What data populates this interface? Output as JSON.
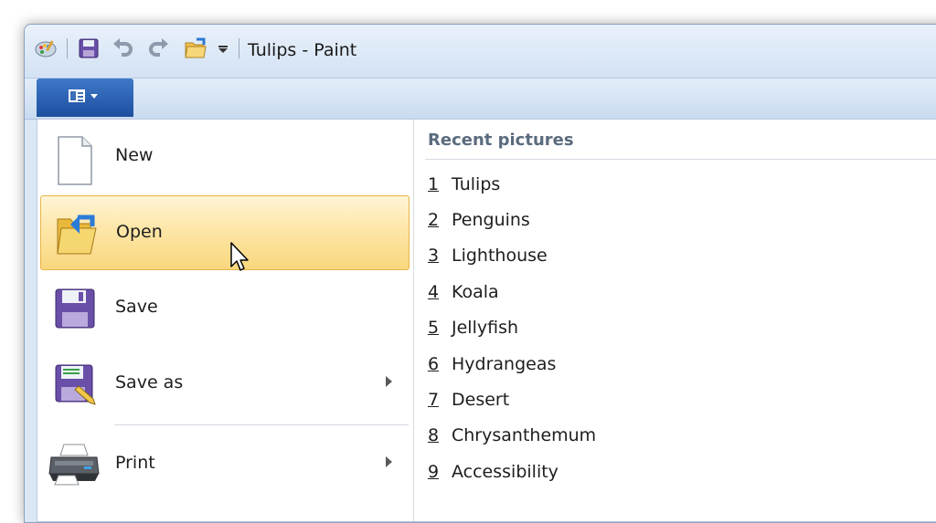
{
  "window": {
    "title": "Tulips - Paint"
  },
  "quick_access": {
    "icons": [
      "paint-app-icon",
      "save-icon",
      "undo-icon",
      "redo-icon",
      "open-folder-icon",
      "customize-dropdown-icon"
    ]
  },
  "app_button": {
    "icon": "paint-menu-icon"
  },
  "menu": {
    "items": [
      {
        "label": "New",
        "icon": "new-document-icon"
      },
      {
        "label": "Open",
        "icon": "open-folder-icon"
      },
      {
        "label": "Save",
        "icon": "floppy-disk-icon"
      },
      {
        "label": "Save as",
        "icon": "save-as-icon"
      },
      {
        "label": "Print",
        "icon": "printer-icon"
      }
    ]
  },
  "recent": {
    "header": "Recent pictures",
    "items": [
      {
        "num": "1",
        "name": "Tulips"
      },
      {
        "num": "2",
        "name": "Penguins"
      },
      {
        "num": "3",
        "name": "Lighthouse"
      },
      {
        "num": "4",
        "name": "Koala"
      },
      {
        "num": "5",
        "name": "Jellyfish"
      },
      {
        "num": "6",
        "name": "Hydrangeas"
      },
      {
        "num": "7",
        "name": "Desert"
      },
      {
        "num": "8",
        "name": "Chrysanthemum"
      },
      {
        "num": "9",
        "name": "Accessibility"
      }
    ]
  },
  "colors": {
    "highlight_top": "#fff4d6",
    "highlight_bottom": "#f9d77e",
    "app_button": "#2a5fb0"
  }
}
